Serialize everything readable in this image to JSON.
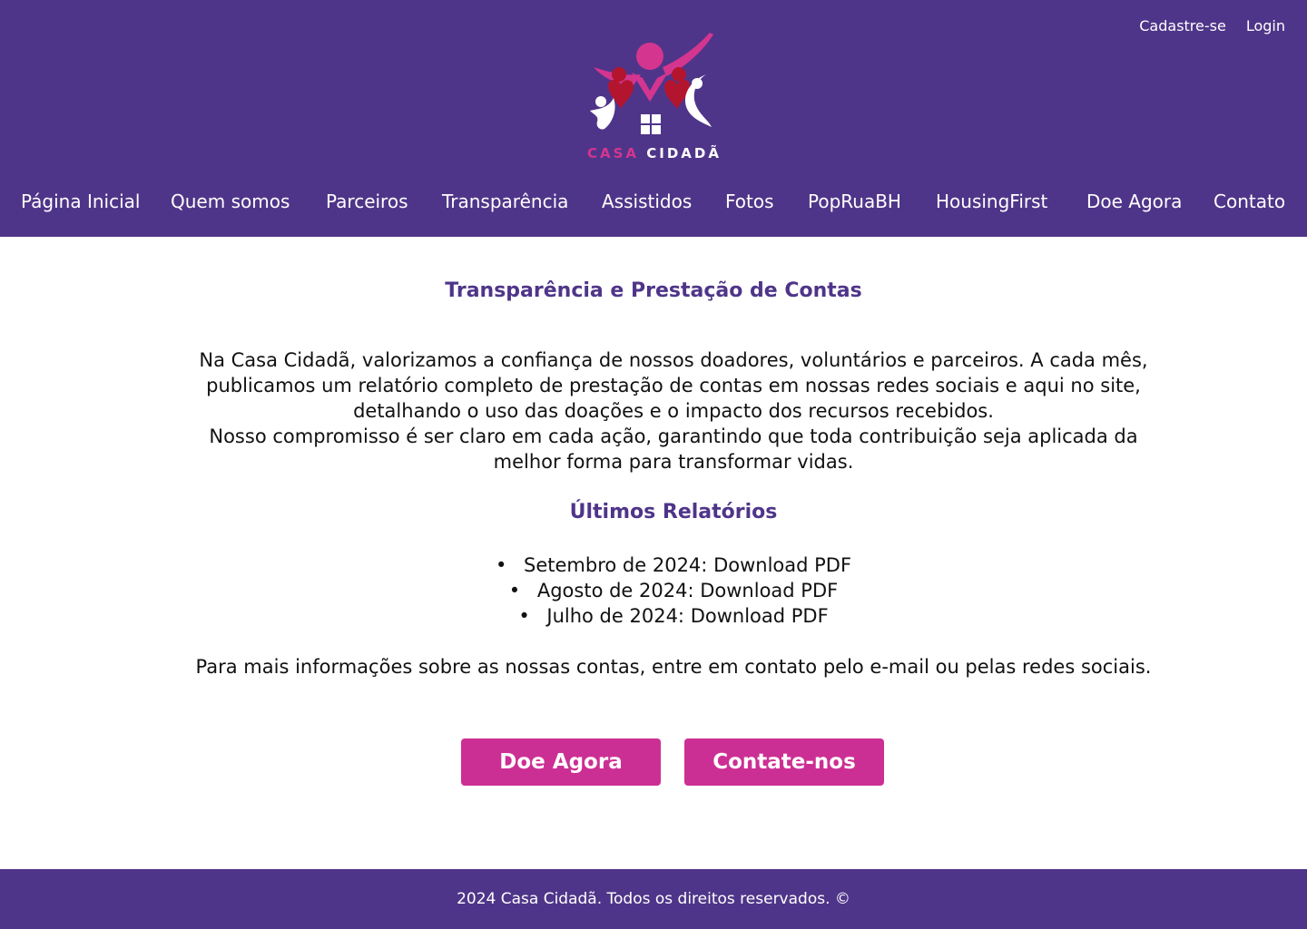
{
  "colors": {
    "primary": "#4f3589",
    "accent": "#cc2f94",
    "text": "#111111",
    "background": "#ffffff"
  },
  "auth": {
    "signup_label": "Cadastre-se",
    "login_label": "Login"
  },
  "logo": {
    "word1": "CASA",
    "word2": "CIDADÃ",
    "icon": "families-house-logo"
  },
  "nav": {
    "items": [
      {
        "label": "Página Inicial"
      },
      {
        "label": "Quem somos"
      },
      {
        "label": "Parceiros"
      },
      {
        "label": "Transparência"
      },
      {
        "label": "Assistidos"
      },
      {
        "label": "Fotos"
      },
      {
        "label": "PopRuaBH"
      },
      {
        "label": "HousingFirst"
      },
      {
        "label": "Doe Agora"
      },
      {
        "label": "Contato"
      }
    ]
  },
  "main": {
    "title": "Transparência e Prestação de Contas",
    "intro_lines": [
      "Na Casa Cidadã, valorizamos a confiança de nossos doadores, voluntários e parceiros. A cada mês,",
      "publicamos um relatório completo de prestação de contas em nossas redes sociais e aqui no site,",
      "detalhando o uso das doações e o impacto dos recursos recebidos.",
      "Nosso compromisso é ser claro em cada ação, garantindo que toda contribuição seja aplicada da",
      "melhor forma para transformar vidas."
    ],
    "reports_title": "Últimos Relatórios",
    "reports": [
      {
        "period": "Setembro de 2024:",
        "link": "Download PDF"
      },
      {
        "period": "Agosto de 2024:",
        "link": "Download PDF"
      },
      {
        "period": "Julho de 2024:",
        "link": "Download PDF"
      }
    ],
    "more_info": "Para mais informações sobre as nossas contas, entre em contato pelo e-mail ou pelas redes sociais.",
    "donate_button": "Doe Agora",
    "contact_button": "Contate-nos"
  },
  "footer": {
    "text": "2024 Casa Cidadã. Todos os direitos reservados. ©"
  }
}
